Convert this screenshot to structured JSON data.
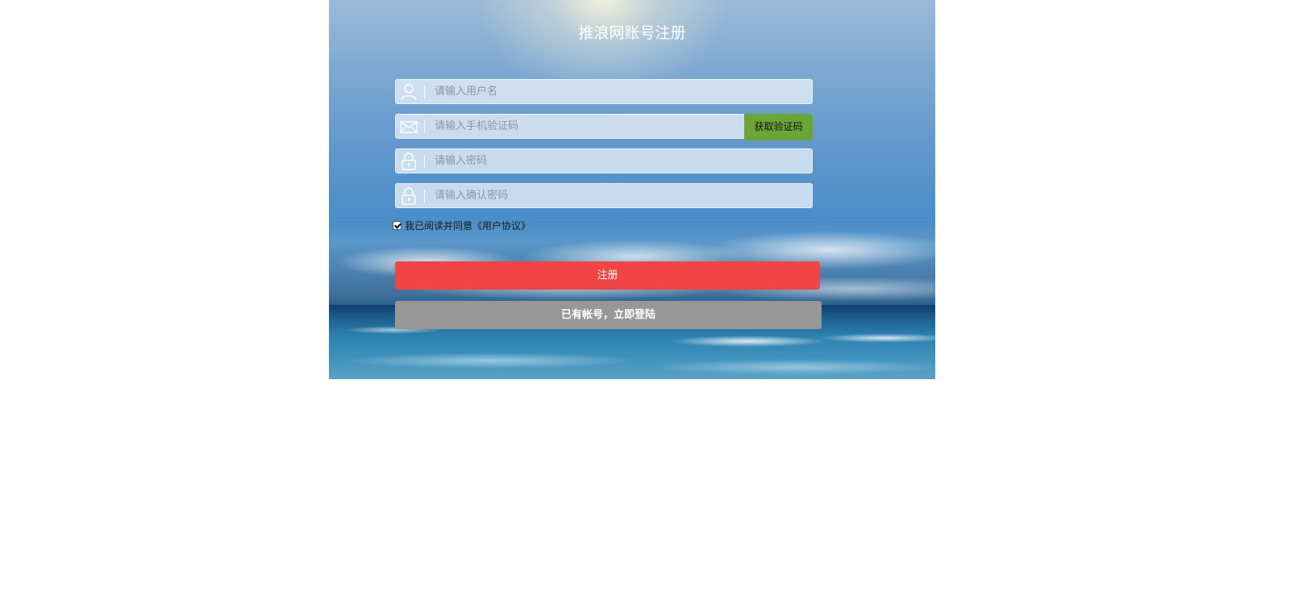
{
  "page": {
    "title": "推浪网账号注册"
  },
  "form": {
    "username": {
      "placeholder": "请输入用户名",
      "value": "",
      "icon": "user-icon"
    },
    "phone_code": {
      "placeholder": "请输入手机验证码",
      "value": "",
      "icon": "mail-icon",
      "button_label": "获取验证码"
    },
    "password": {
      "placeholder": "请输入密码",
      "value": "",
      "icon": "lock-icon"
    },
    "confirm_password": {
      "placeholder": "请输入确认密码",
      "value": "",
      "icon": "lock-icon"
    },
    "agreement": {
      "label": "我已阅读并同意《用户协议》",
      "checked": true
    }
  },
  "actions": {
    "register_label": "注册",
    "login_label": "已有帐号，立即登陆"
  },
  "colors": {
    "register_button": "#f14545",
    "login_button": "#979797",
    "code_button": "#6aa636"
  }
}
